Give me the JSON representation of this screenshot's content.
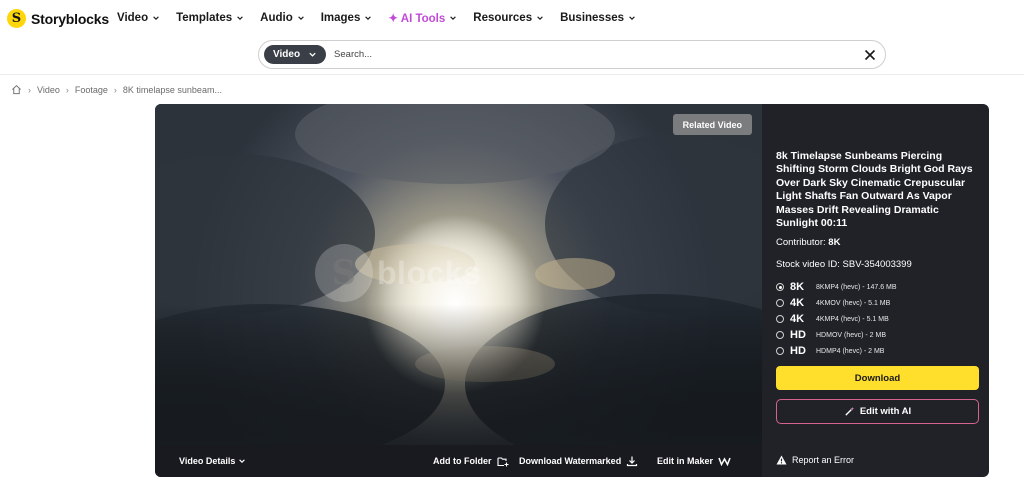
{
  "brand": {
    "name": "Storyblocks",
    "mark": "S"
  },
  "nav": {
    "items": [
      {
        "label": "Video"
      },
      {
        "label": "Templates"
      },
      {
        "label": "Audio"
      },
      {
        "label": "Images"
      },
      {
        "label": "✦ AI Tools"
      },
      {
        "label": "Resources"
      },
      {
        "label": "Businesses"
      }
    ]
  },
  "search": {
    "type_label": "Video",
    "placeholder": "Search..."
  },
  "breadcrumb": {
    "items": [
      "Video",
      "Footage",
      "8K timelapse sunbeam..."
    ]
  },
  "player": {
    "related_label": "Related Video",
    "watermark_text": "blocks",
    "watermark_mark": "S",
    "bar": {
      "details_label": "Video Details",
      "add_folder_label": "Add to Folder",
      "download_wm_label": "Download Watermarked",
      "edit_maker_label": "Edit in Maker"
    }
  },
  "panel": {
    "title": "8k Timelapse Sunbeams Piercing Shifting Storm Clouds Bright God Rays Over Dark Sky Cinematic Crepuscular Light Shafts Fan Outward As Vapor Masses Drift Revealing Dramatic Sunlight 00:11",
    "contributor_label": "Contributor:",
    "contributor_value": "8K",
    "stock_id_label": "Stock video ID:",
    "stock_id_value": "SBV-354003399",
    "formats": [
      {
        "res": "8K",
        "desc": "8KMP4 (hevc) - 147.6 MB",
        "selected": true
      },
      {
        "res": "4K",
        "desc": "4KMOV (hevc) - 5.1 MB",
        "selected": false
      },
      {
        "res": "4K",
        "desc": "4KMP4 (hevc) - 5.1 MB",
        "selected": false
      },
      {
        "res": "HD",
        "desc": "HDMOV (hevc) - 2 MB",
        "selected": false
      },
      {
        "res": "HD",
        "desc": "HDMP4 (hevc) - 2 MB",
        "selected": false
      }
    ],
    "download_label": "Download",
    "ai_label": "Edit with AI",
    "report_label": "Report an Error"
  },
  "colors": {
    "accent": "#ffde2c",
    "ai": "#c04bd6",
    "panel": "#202228",
    "bar": "#181a1f"
  }
}
